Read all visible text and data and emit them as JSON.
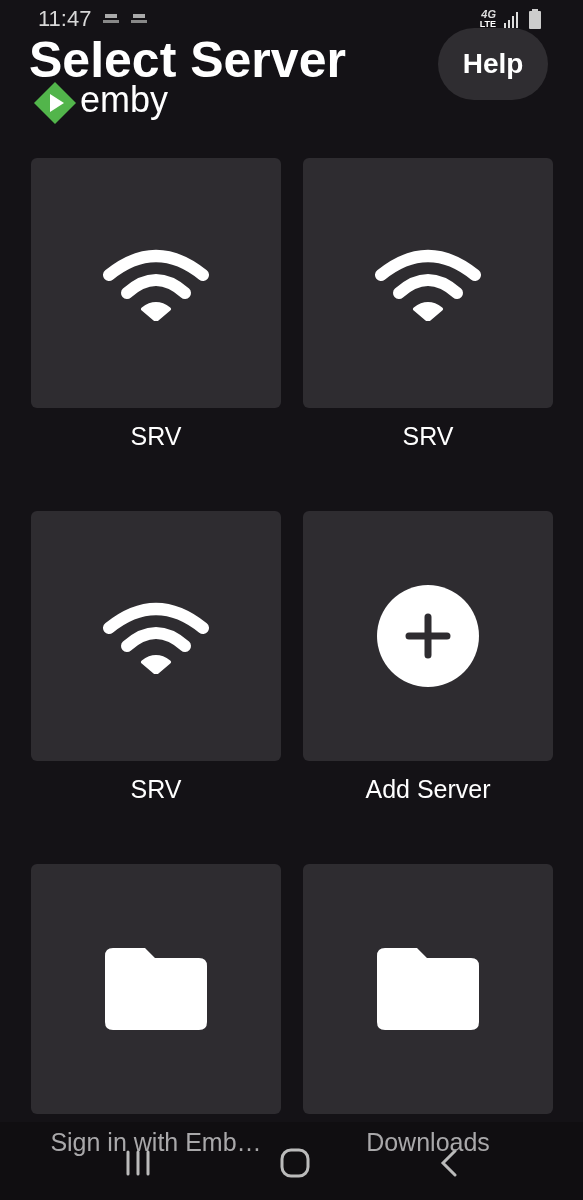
{
  "status_bar": {
    "time": "11:47",
    "network": "4G",
    "network_sub": "LTE"
  },
  "title": "Select Server",
  "help_button": "Help",
  "logo_text": "emby",
  "tiles": [
    {
      "kind": "server",
      "label": "SRV",
      "dimmed": false
    },
    {
      "kind": "server",
      "label": "SRV",
      "dimmed": false
    },
    {
      "kind": "server",
      "label": "SRV",
      "dimmed": false
    },
    {
      "kind": "add",
      "label": "Add Server",
      "dimmed": false
    },
    {
      "kind": "folder",
      "label": "Sign in with Emb…",
      "dimmed": true
    },
    {
      "kind": "folder",
      "label": "Downloads",
      "dimmed": true
    }
  ]
}
